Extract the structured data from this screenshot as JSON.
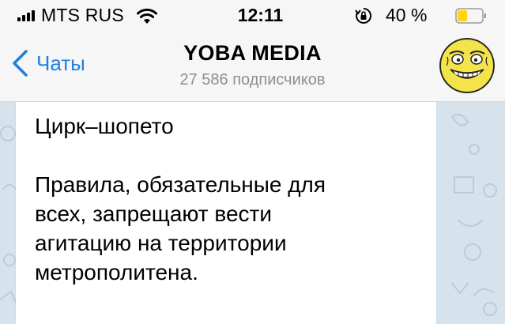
{
  "status_bar": {
    "carrier": "MTS RUS",
    "time": "12:11",
    "battery_percent": "40 %",
    "battery_level": 0.4,
    "icons": [
      "signal-icon",
      "wifi-icon",
      "orientation-lock-icon",
      "battery-icon"
    ]
  },
  "header": {
    "back_label": "Чаты",
    "title": "YOBA MEDIA",
    "subtitle": "27 586 подписчиков",
    "avatar": "yoba-avatar"
  },
  "message": {
    "title": "Цирк–шопето",
    "lines": [
      "Правила, обязательные для",
      "всех, запрещают вести",
      "агитацию на территории",
      "метрополитена."
    ]
  },
  "colors": {
    "accent": "#1f7fe0",
    "subtitle": "#8e8e93",
    "chat_background": "#d6e2ec",
    "battery_fill": "#ffd60a"
  }
}
